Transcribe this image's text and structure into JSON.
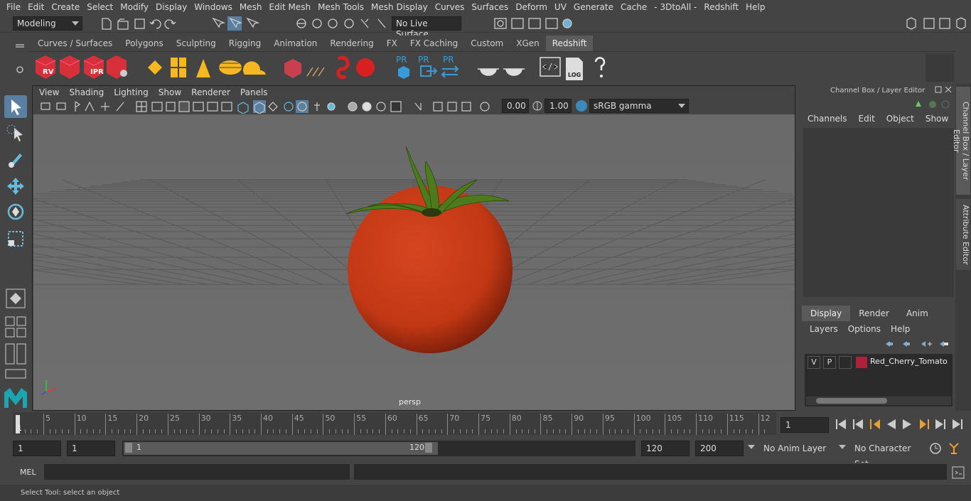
{
  "menu": [
    "File",
    "Edit",
    "Create",
    "Select",
    "Modify",
    "Display",
    "Windows",
    "Mesh",
    "Edit Mesh",
    "Mesh Tools",
    "Mesh Display",
    "Curves",
    "Surfaces",
    "Deform",
    "UV",
    "Generate",
    "Cache",
    "- 3DtoAll -",
    "Redshift",
    "Help"
  ],
  "status": {
    "mode": "Modeling",
    "live_surface": "No Live Surface"
  },
  "shelf_tabs": [
    "Curves / Surfaces",
    "Polygons",
    "Sculpting",
    "Rigging",
    "Animation",
    "Rendering",
    "FX",
    "FX Caching",
    "Custom",
    "XGen",
    "Redshift"
  ],
  "shelf_active": "Redshift",
  "shelf_labels": {
    "rv": "RV",
    "ipr": "IPR",
    "pr1": "PR",
    "pr2": "PR",
    "pr3": "PR",
    "log": "LOG",
    "help": "?"
  },
  "viewport": {
    "menu": [
      "View",
      "Shading",
      "Lighting",
      "Show",
      "Renderer",
      "Panels"
    ],
    "exposure": "0.00",
    "gamma": "1.00",
    "colorspace": "sRGB gamma",
    "camera": "persp"
  },
  "channel_box": {
    "title": "Channel Box / Layer Editor",
    "menu": [
      "Channels",
      "Edit",
      "Object",
      "Show"
    ]
  },
  "layer_editor": {
    "tabs": [
      "Display",
      "Render",
      "Anim"
    ],
    "active_tab": "Display",
    "menu": [
      "Layers",
      "Options",
      "Help"
    ],
    "layer": {
      "v": "V",
      "p": "P",
      "name": "Red_Cherry_Tomato",
      "color": "#b0203a"
    }
  },
  "side_tabs": [
    "Channel Box / Layer Editor",
    "Attribute Editor"
  ],
  "timeline": {
    "ticks": [
      "5",
      "10",
      "15",
      "20",
      "25",
      "30",
      "35",
      "40",
      "45",
      "50",
      "55",
      "60",
      "65",
      "70",
      "75",
      "80",
      "85",
      "90",
      "95",
      "100",
      "105",
      "110",
      "115",
      "12"
    ],
    "start_label": "1",
    "current_frame": "1"
  },
  "range": {
    "start": "1",
    "playback_start": "1",
    "slider_start": "1",
    "slider_end": "120",
    "end": "120",
    "anim_end": "200",
    "anim_layer": "No Anim Layer",
    "character_set": "No Character Set"
  },
  "cmd": {
    "lang": "MEL"
  },
  "help": "Select Tool: select an object",
  "colors": {
    "tomato": "#c83a1a",
    "stem": "#4e7a1e",
    "accent": "#5285a6"
  }
}
